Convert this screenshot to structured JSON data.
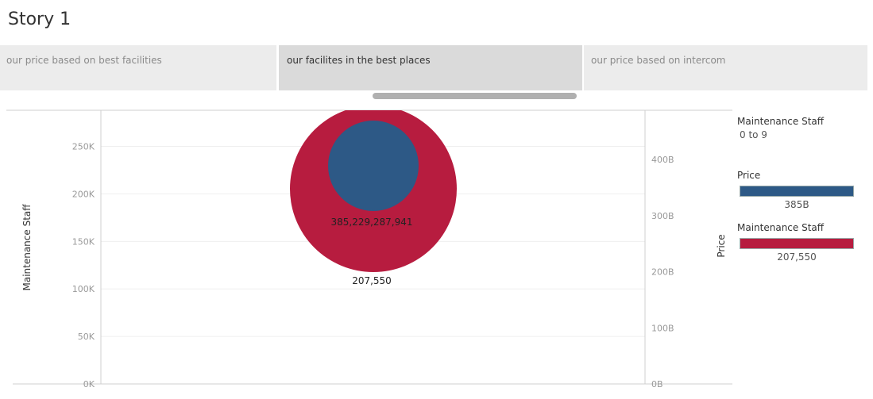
{
  "story": {
    "title": "Story 1"
  },
  "tabs": [
    {
      "label": "our price based on best facilities",
      "active": false
    },
    {
      "label": "our facilites in the best places",
      "active": true
    },
    {
      "label": "our price based on intercom",
      "active": false
    }
  ],
  "colors": {
    "price": "#2d5986",
    "maintenance": "#b71c3f"
  },
  "chart_data": {
    "type": "scatter",
    "title": "",
    "left_axis": {
      "label": "Maintenance Staff",
      "ticks": [
        "0K",
        "50K",
        "100K",
        "150K",
        "200K",
        "250K"
      ],
      "tick_values": [
        0,
        50000,
        100000,
        150000,
        200000,
        250000
      ],
      "range": [
        0,
        288000
      ]
    },
    "right_axis": {
      "label": "Price",
      "ticks": [
        "0B",
        "100B",
        "200B",
        "300B",
        "400B"
      ],
      "tick_values": [
        0,
        100000000000,
        200000000000,
        300000000000,
        400000000000
      ],
      "range": [
        0,
        488000000000
      ]
    },
    "series": [
      {
        "name": "Maintenance Staff",
        "value": 207550,
        "label": "207,550",
        "axis": "left"
      },
      {
        "name": "Price",
        "value": 385229287941,
        "label": "385,229,287,941",
        "axis": "right"
      }
    ],
    "grid": true
  },
  "legend": {
    "color_title": "Maintenance Staff",
    "color_range": "0 to 9",
    "size_items": [
      {
        "title": "Price",
        "value": "385B"
      },
      {
        "title": "Maintenance Staff",
        "value": "207,550"
      }
    ]
  }
}
